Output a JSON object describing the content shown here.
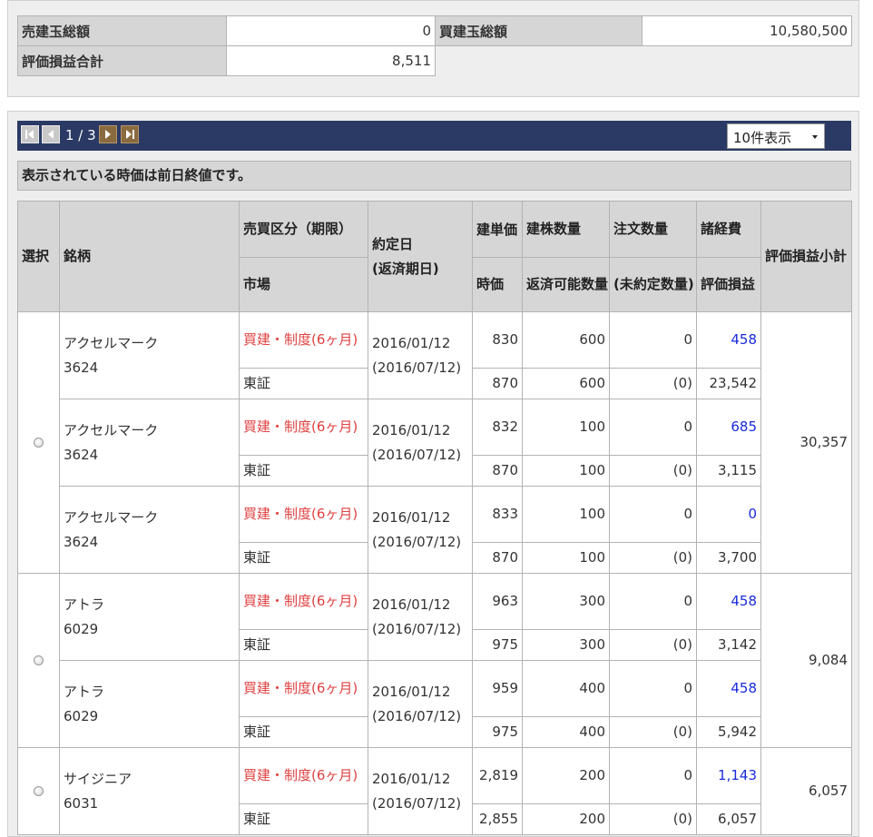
{
  "summary": {
    "sell_total_label": "売建玉総額",
    "sell_total_value": "0",
    "buy_total_label": "買建玉総額",
    "buy_total_value": "10,580,500",
    "pl_total_label": "評価損益合計",
    "pl_total_value": "8,511"
  },
  "pager": {
    "page_text": "1 / 3",
    "per_page_selected": "10件表示"
  },
  "notice": "表示されている時価は前日終値です。",
  "table": {
    "headers": {
      "select": "選択",
      "stock": "銘柄",
      "trade_type": "売買区分（期限）",
      "market": "市場",
      "contract_date": "約定日",
      "due_date": "(返済期日)",
      "unit_price": "建単価",
      "current_price": "時価",
      "qty": "建株数量",
      "repayable_qty": "返済可能数量",
      "order_qty": "注文数量",
      "unfilled_qty": "(未約定数量)",
      "fees": "諸経費",
      "pl": "評価損益",
      "subtotal": "評価損益小計"
    },
    "groups": [
      {
        "subtotal": "30,357",
        "rows": [
          {
            "name": "アクセルマーク",
            "code": "3624",
            "type": "買建・制度(6ヶ月)",
            "market": "東証",
            "date": "2016/01/12",
            "due": "(2016/07/12)",
            "price": "830",
            "cur_price": "870",
            "qty": "600",
            "rep_qty": "600",
            "order": "0",
            "unfilled": "(0)",
            "fee": "458",
            "pl": "23,542"
          },
          {
            "name": "アクセルマーク",
            "code": "3624",
            "type": "買建・制度(6ヶ月)",
            "market": "東証",
            "date": "2016/01/12",
            "due": "(2016/07/12)",
            "price": "832",
            "cur_price": "870",
            "qty": "100",
            "rep_qty": "100",
            "order": "0",
            "unfilled": "(0)",
            "fee": "685",
            "pl": "3,115"
          },
          {
            "name": "アクセルマーク",
            "code": "3624",
            "type": "買建・制度(6ヶ月)",
            "market": "東証",
            "date": "2016/01/12",
            "due": "(2016/07/12)",
            "price": "833",
            "cur_price": "870",
            "qty": "100",
            "rep_qty": "100",
            "order": "0",
            "unfilled": "(0)",
            "fee": "0",
            "pl": "3,700"
          }
        ]
      },
      {
        "subtotal": "9,084",
        "rows": [
          {
            "name": "アトラ",
            "code": "6029",
            "type": "買建・制度(6ヶ月)",
            "market": "東証",
            "date": "2016/01/12",
            "due": "(2016/07/12)",
            "price": "963",
            "cur_price": "975",
            "qty": "300",
            "rep_qty": "300",
            "order": "0",
            "unfilled": "(0)",
            "fee": "458",
            "pl": "3,142"
          },
          {
            "name": "アトラ",
            "code": "6029",
            "type": "買建・制度(6ヶ月)",
            "market": "東証",
            "date": "2016/01/12",
            "due": "(2016/07/12)",
            "price": "959",
            "cur_price": "975",
            "qty": "400",
            "rep_qty": "400",
            "order": "0",
            "unfilled": "(0)",
            "fee": "458",
            "pl": "5,942"
          }
        ]
      },
      {
        "subtotal": "6,057",
        "rows": [
          {
            "name": "サイジニア",
            "code": "6031",
            "type": "買建・制度(6ヶ月)",
            "market": "東証",
            "date": "2016/01/12",
            "due": "(2016/07/12)",
            "price": "2,819",
            "cur_price": "2,855",
            "qty": "200",
            "rep_qty": "200",
            "order": "0",
            "unfilled": "(0)",
            "fee": "1,143",
            "pl": "6,057"
          }
        ]
      }
    ]
  }
}
